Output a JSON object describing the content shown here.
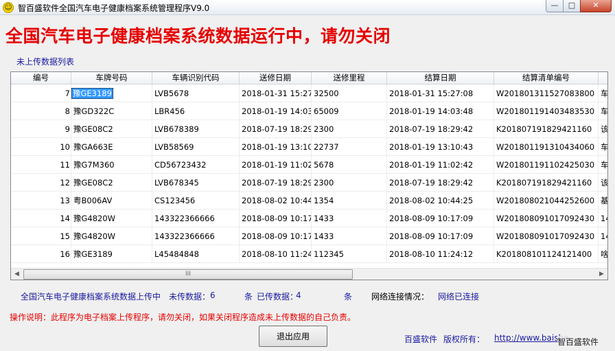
{
  "window": {
    "title": "智百盛软件全国汽车电子健康档案系统管理程序V9.0",
    "icon": "smiley-icon",
    "min_glyph": "—",
    "max_glyph": "□",
    "close_glyph": "✕"
  },
  "banner": "全国汽车电子健康档案系统数据运行中，请勿关闭",
  "list_title": "未上传数据列表",
  "table": {
    "headers": [
      "编号",
      "车牌号码",
      "车辆识别代码",
      "送修日期",
      "送修里程",
      "结算日期",
      "结算清单编号",
      ""
    ],
    "rows": [
      {
        "id": "7",
        "plate": "豫GE3189",
        "vin": "LVB5678",
        "repair_date": "2018-01-31 15:27:",
        "mileage": "32500",
        "settle_date": "2018-01-31 15:27:08",
        "bill_no": "W201801311527083800",
        "extra": "车"
      },
      {
        "id": "8",
        "plate": "豫GD322C",
        "vin": "LBR456",
        "repair_date": "2018-01-19 14:03:",
        "mileage": "65009",
        "settle_date": "2018-01-19 14:03:48",
        "bill_no": "W201801191403483530",
        "extra": "车"
      },
      {
        "id": "9",
        "plate": "豫GE08C2",
        "vin": "LVB678389",
        "repair_date": "2018-07-19 18:29:",
        "mileage": "2300",
        "settle_date": "2018-07-19 18:29:42",
        "bill_no": "K201807191829421160",
        "extra": "该"
      },
      {
        "id": "10",
        "plate": "豫GA663E",
        "vin": "LVB58569",
        "repair_date": "2018-01-19 13:10:",
        "mileage": "22737",
        "settle_date": "2018-01-19 13:10:43",
        "bill_no": "W201801191310434060",
        "extra": "车"
      },
      {
        "id": "11",
        "plate": "豫G7M360",
        "vin": "CD56723432",
        "repair_date": "2018-01-19 11:02:",
        "mileage": "5678",
        "settle_date": "2018-01-19 11:02:42",
        "bill_no": "W201801191102425030",
        "extra": "车"
      },
      {
        "id": "12",
        "plate": "豫GE08C2",
        "vin": "LVB678345",
        "repair_date": "2018-07-19 18:29:",
        "mileage": "2300",
        "settle_date": "2018-07-19 18:29:42",
        "bill_no": "K201807191829421160",
        "extra": "该"
      },
      {
        "id": "13",
        "plate": "粤B006AV",
        "vin": "CS123456",
        "repair_date": "2018-08-02 10:44:",
        "mileage": "1354",
        "settle_date": "2018-08-02 10:44:25",
        "bill_no": "W201808021044252600",
        "extra": "基"
      },
      {
        "id": "14",
        "plate": "豫G4820W",
        "vin": "143322366666",
        "repair_date": "2018-08-09 10:17:",
        "mileage": "1433",
        "settle_date": "2018-08-09 10:17:09",
        "bill_no": "W201808091017092430",
        "extra": "14"
      },
      {
        "id": "15",
        "plate": "豫G4820W",
        "vin": "143322366666",
        "repair_date": "2018-08-09 10:17:",
        "mileage": "1433",
        "settle_date": "2018-08-09 10:17:09",
        "bill_no": "W201808091017092430",
        "extra": "14"
      },
      {
        "id": "16",
        "plate": "豫GE3189",
        "vin": "L45484848",
        "repair_date": "2018-08-10 11:24:",
        "mileage": "112345",
        "settle_date": "2018-08-10 11:24:12",
        "bill_no": "K201808101124121400",
        "extra": "啥"
      }
    ]
  },
  "scrollbar": {
    "left_arrow": "◀",
    "right_arrow": "▶",
    "grip": "III"
  },
  "status": {
    "label": "全国汽车电子健康档案系统数据上传中",
    "pending_label": "未传数据：",
    "pending_count": "6",
    "unit1": "条",
    "uploaded_label": "已传数据：",
    "uploaded_count": "4",
    "unit2": "条",
    "network_label": "网络连接情况：",
    "network_value": "网络已连接"
  },
  "note": "操作说明：此程序为电子档案上传程序，请勿关闭，如果关闭程序造成未上传数据的自己负责。",
  "exit_button": "退出应用",
  "footer": {
    "company": "百盛软件",
    "copyright": "版权所有：",
    "link": "http://www.baishe",
    "watermark": "智百盛软件"
  }
}
